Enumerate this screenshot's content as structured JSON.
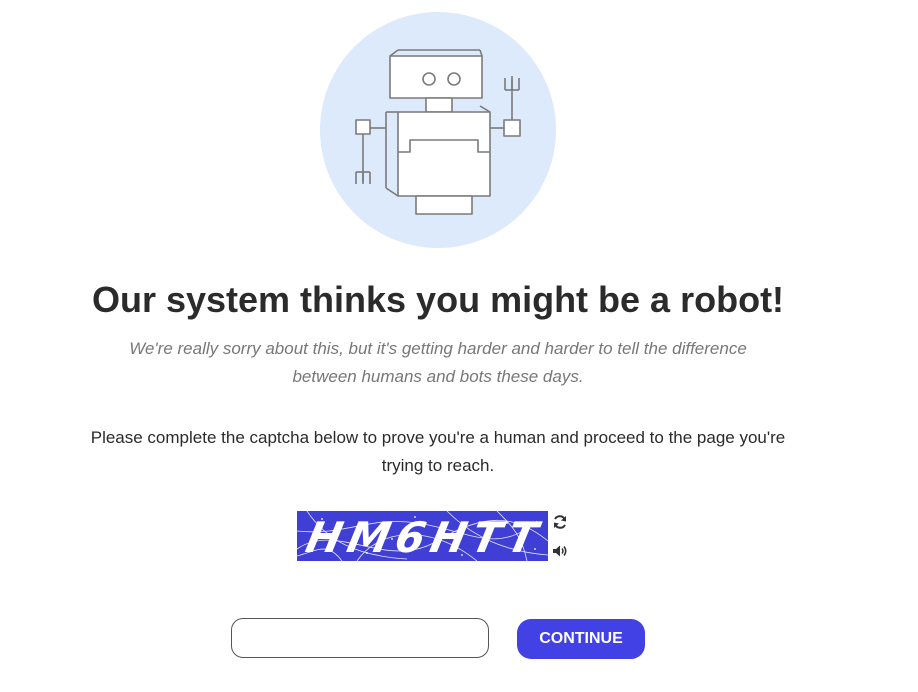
{
  "illustration": {
    "icon": "robot-icon",
    "circle_color": "#ddeafb"
  },
  "heading": {
    "title": "Our system thinks you might be a robot!",
    "apology": "We're really sorry about this, but it's getting harder and harder to tell the difference between humans and bots these days."
  },
  "instructions": {
    "text": "Please complete the captcha below to prove you're a human and proceed to the page you're trying to reach."
  },
  "captcha": {
    "text": "HM6HTT",
    "background_color": "#3f3fd6",
    "refresh_icon": "refresh-icon",
    "audio_icon": "speaker-icon"
  },
  "form": {
    "input_value": "",
    "input_placeholder": "",
    "continue_label": "CONTINUE",
    "accent_color": "#4141e6"
  }
}
